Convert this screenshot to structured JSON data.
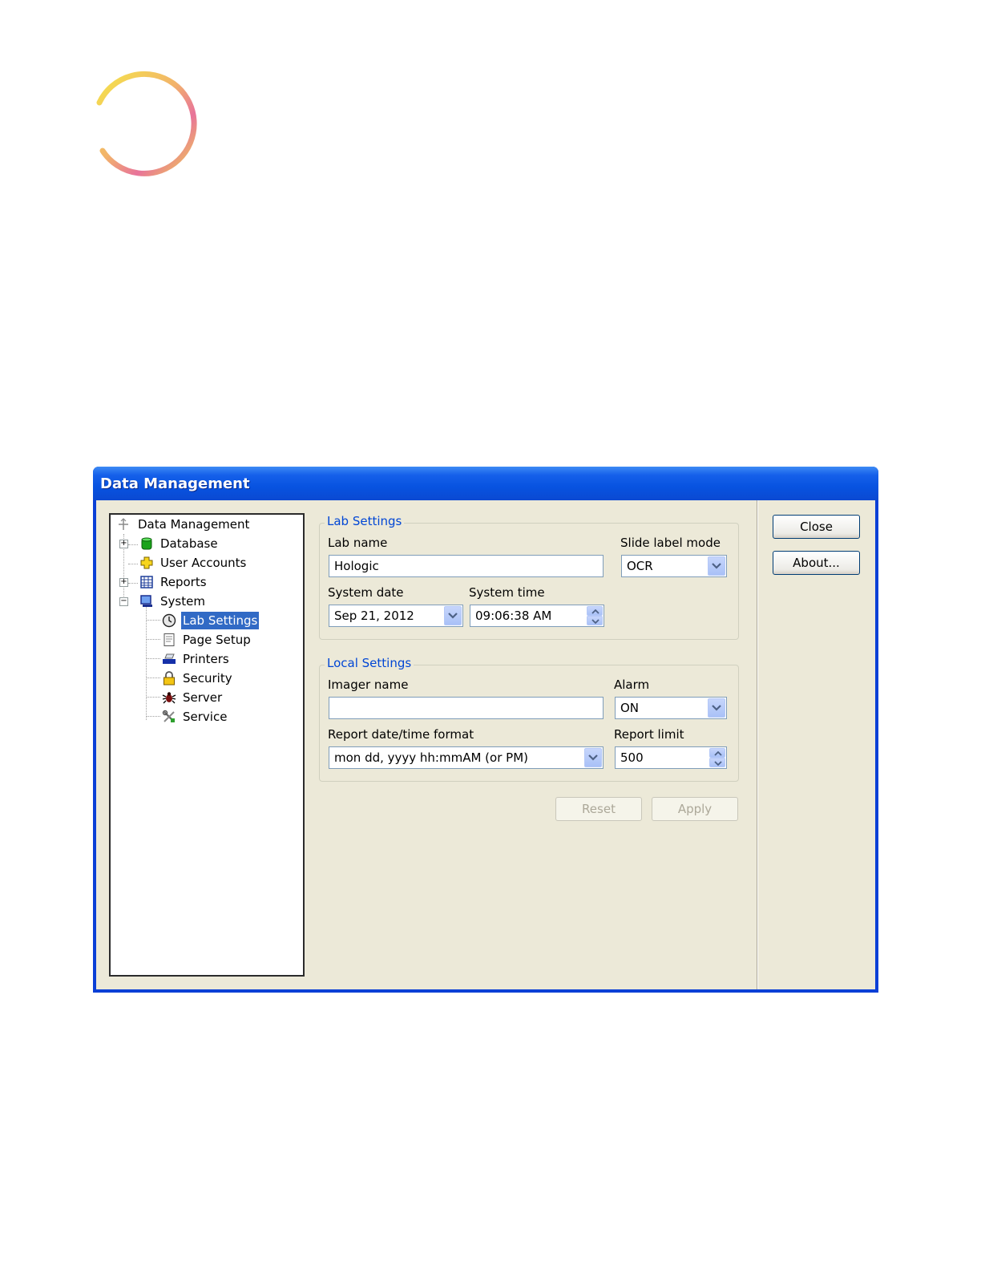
{
  "window": {
    "title": "Data Management"
  },
  "tree": {
    "items": [
      {
        "label": "Data Management",
        "icon": "data-management-icon"
      },
      {
        "label": "Database",
        "icon": "database-icon"
      },
      {
        "label": "User Accounts",
        "icon": "user-accounts-icon"
      },
      {
        "label": "Reports",
        "icon": "reports-icon"
      },
      {
        "label": "System",
        "icon": "system-icon"
      },
      {
        "label": "Lab Settings",
        "icon": "clock-icon",
        "selected": true
      },
      {
        "label": "Page Setup",
        "icon": "page-icon"
      },
      {
        "label": "Printers",
        "icon": "printer-icon"
      },
      {
        "label": "Security",
        "icon": "lock-icon"
      },
      {
        "label": "Server",
        "icon": "bug-icon"
      },
      {
        "label": "Service",
        "icon": "tools-icon"
      }
    ]
  },
  "lab_settings": {
    "title": "Lab Settings",
    "lab_name_label": "Lab name",
    "lab_name_value": "Hologic",
    "slide_label_mode_label": "Slide label mode",
    "slide_label_mode_value": "OCR",
    "system_date_label": "System date",
    "system_date_value": "Sep 21, 2012",
    "system_time_label": "System time",
    "system_time_value": "09:06:38 AM"
  },
  "local_settings": {
    "title": "Local Settings",
    "imager_name_label": "Imager name",
    "imager_name_value": "",
    "alarm_label": "Alarm",
    "alarm_value": "ON",
    "report_format_label": "Report date/time format",
    "report_format_value": "mon dd, yyyy hh:mmAM (or PM)",
    "report_limit_label": "Report limit",
    "report_limit_value": "500"
  },
  "buttons": {
    "reset": "Reset",
    "apply": "Apply",
    "close": "Close",
    "about": "About..."
  },
  "colors": {
    "title_bar": "#0a49d2",
    "selection": "#316ac5",
    "group_title": "#0046d5",
    "dialog_bg": "#ece9d8"
  }
}
